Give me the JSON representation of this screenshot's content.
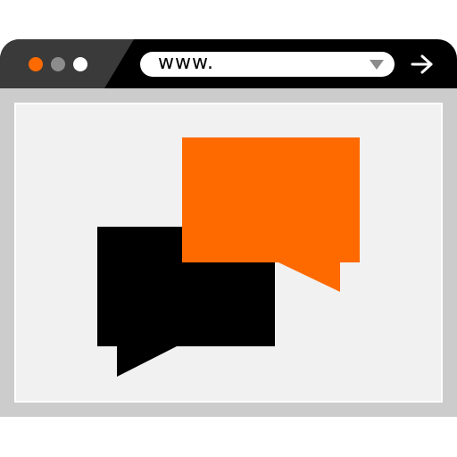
{
  "browser": {
    "address_bar": {
      "text": "www."
    },
    "controls": {
      "close_color": "#ff6a00",
      "minimize_color": "#8c8c8c",
      "maximize_color": "#ffffff"
    },
    "icons": {
      "dropdown": "chevron-down-icon",
      "go": "arrow-right-icon"
    }
  },
  "content": {
    "illustration": "chat-bubbles-icon",
    "bubble_colors": {
      "front": "#ff6a00",
      "back": "#000000"
    }
  }
}
